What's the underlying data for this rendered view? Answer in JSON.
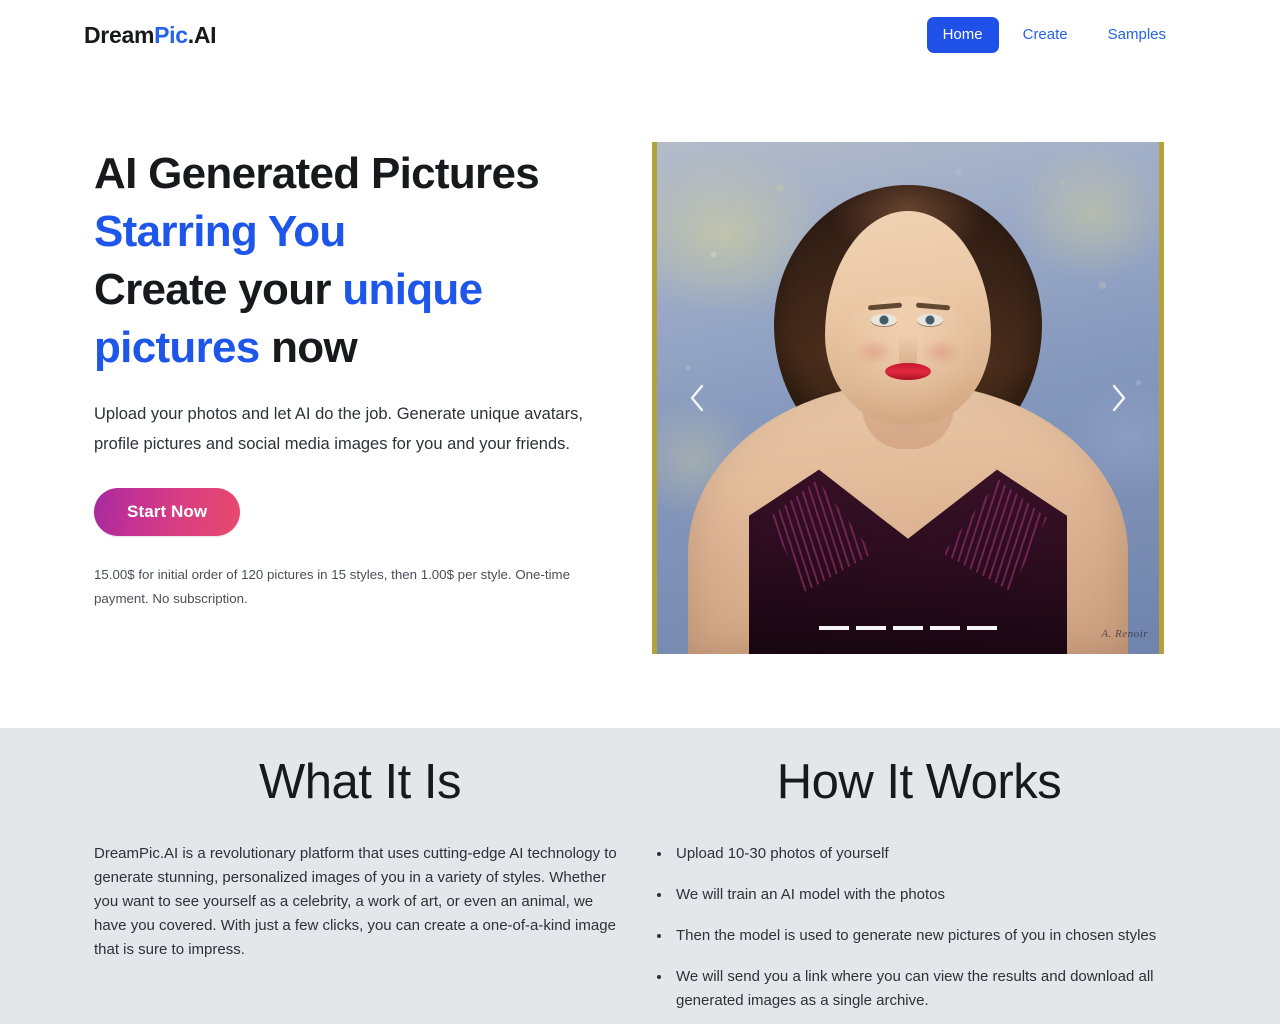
{
  "header": {
    "brand_prefix": "Dream",
    "brand_accent": "Pic",
    "brand_suffix": ".AI",
    "nav": [
      {
        "label": "Home",
        "active": true
      },
      {
        "label": "Create",
        "active": false
      },
      {
        "label": "Samples",
        "active": false
      }
    ]
  },
  "hero": {
    "title_line1": "AI Generated Pictures",
    "title_line2_accent": "Starring You",
    "title_line3_plain_a": "Create your ",
    "title_line3_accent": "unique",
    "title_line4_accent": "pictures",
    "title_line4_plain": " now",
    "subtitle": "Upload your photos and let AI do the job. Generate unique avatars, profile pictures and social media images for you and your friends.",
    "cta_label": "Start Now",
    "price_note": "15.00$ for initial order of 120 pictures in 15 styles, then 1.00$ per style. One-time payment. No subscription.",
    "carousel": {
      "prev_icon": "chevron-left-icon",
      "next_icon": "chevron-right-icon",
      "slide_count": 5,
      "active_slide": 1,
      "image_alt": "AI generated impressionist portrait of a woman with dark wavy hair in a dark purple strapless dress",
      "signature": "A. Renoir"
    }
  },
  "info": {
    "what_it_is": {
      "heading": "What It Is",
      "body": "DreamPic.AI is a revolutionary platform that uses cutting-edge AI technology to generate stunning, personalized images of you in a variety of styles. Whether you want to see yourself as a celebrity, a work of art, or even an animal, we have you covered. With just a few clicks, you can create a one-of-a-kind image that is sure to impress."
    },
    "how_it_works": {
      "heading": "How It Works",
      "steps": [
        "Upload 10-30 photos of yourself",
        "We will train an AI model with the photos",
        "Then the model is used to generate new pictures of you in chosen styles",
        "We will send you a link where you can view the results and download all generated images as a single archive."
      ]
    }
  },
  "colors": {
    "brand_blue": "#2563eb",
    "nav_active_bg": "#1f50e8",
    "heading_accent": "#1f56ea",
    "cta_gradient_from": "#a52aa0",
    "cta_gradient_to": "#e8496c",
    "info_section_bg": "#e4e6ea",
    "text_dark": "#17191c"
  }
}
